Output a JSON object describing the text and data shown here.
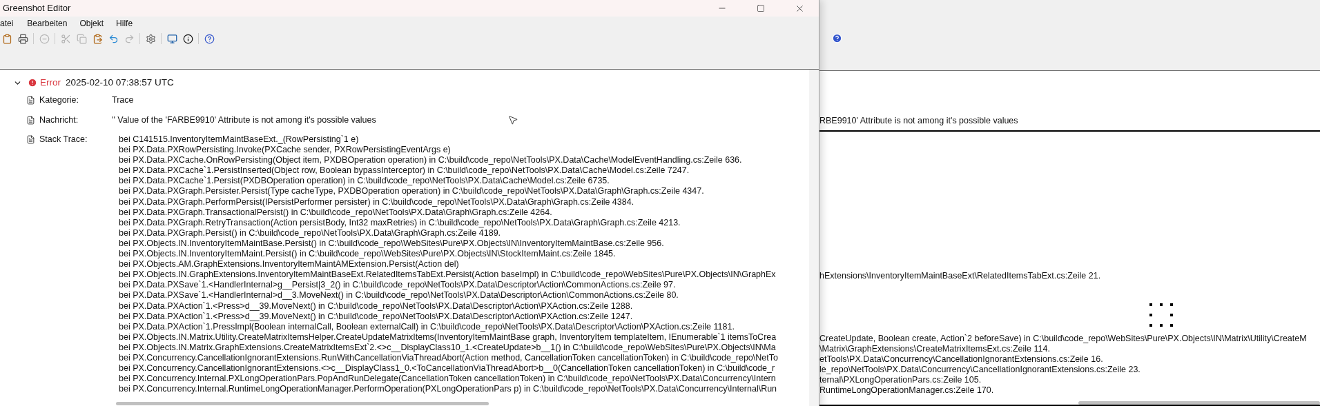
{
  "window": {
    "title": "Greenshot Editor"
  },
  "menu": [
    "atei",
    "Bearbeiten",
    "Objekt",
    "Hilfe"
  ],
  "toolbar": [
    {
      "disabled": false
    },
    {
      "disabled": false
    },
    {
      "disabled": true
    },
    {
      "disabled": true
    },
    {
      "disabled": true
    },
    {
      "disabled": false
    },
    {
      "disabled": false
    },
    {
      "disabled": true
    },
    {
      "disabled": false
    },
    {
      "disabled": false
    },
    {
      "disabled": false
    },
    {
      "disabled": false
    }
  ],
  "log_entry": {
    "expanded": true,
    "level": "Error",
    "timestamp": "2025-02-10 07:38:57 UTC",
    "fields": [
      {
        "label": "Kategorie:",
        "value": "Trace"
      },
      {
        "label": "Nachricht:",
        "value": "'' Value of the 'FARBE9910' Attribute is not among it's possible values",
        "continuation": "RBE9910' Attribute is not among it's possible values"
      }
    ],
    "stack_trace": {
      "label": "Stack Trace:",
      "lines": [
        {
          "text": "bei C141515.InventoryItemMaintBaseExt._(RowPersisting`1 e)"
        },
        {
          "text": "bei PX.Data.PXRowPersisting.Invoke(PXCache sender, PXRowPersistingEventArgs e)"
        },
        {
          "text": "bei PX.Data.PXCache.OnRowPersisting(Object item, PXDBOperation operation) in C:\\build\\code_repo\\NetTools\\PX.Data\\Cache\\ModelEventHandling.cs:Zeile 636."
        },
        {
          "text": "bei PX.Data.PXCache`1.PersistInserted(Object row, Boolean bypassInterceptor) in C:\\build\\code_repo\\NetTools\\PX.Data\\Cache\\Model.cs:Zeile 7247."
        },
        {
          "text": "bei PX.Data.PXCache`1.Persist(PXDBOperation operation) in C:\\build\\code_repo\\NetTools\\PX.Data\\Cache\\Model.cs:Zeile 6735."
        },
        {
          "text": "bei PX.Data.PXGraph.Persister.Persist(Type cacheType, PXDBOperation operation) in C:\\build\\code_repo\\NetTools\\PX.Data\\Graph\\Graph.cs:Zeile 4347."
        },
        {
          "text": "bei PX.Data.PXGraph.PerformPersist(IPersistPerformer persister) in C:\\build\\code_repo\\NetTools\\PX.Data\\Graph\\Graph.cs:Zeile 4384."
        },
        {
          "text": "bei PX.Data.PXGraph.TransactionalPersist() in C:\\build\\code_repo\\NetTools\\PX.Data\\Graph\\Graph.cs:Zeile 4264."
        },
        {
          "text": "bei PX.Data.PXGraph.RetryTransaction(Action persistBody, Int32 maxRetries) in C:\\build\\code_repo\\NetTools\\PX.Data\\Graph\\Graph.cs:Zeile 4213."
        },
        {
          "text": "bei PX.Data.PXGraph.Persist() in C:\\build\\code_repo\\NetTools\\PX.Data\\Graph\\Graph.cs:Zeile 4189."
        },
        {
          "text": "bei PX.Objects.IN.InventoryItemMaintBase.Persist() in C:\\build\\code_repo\\WebSites\\Pure\\PX.Objects\\IN\\InventoryItemMaintBase.cs:Zeile 956."
        },
        {
          "text": "bei PX.Objects.IN.InventoryItemMaint.Persist() in C:\\build\\code_repo\\WebSites\\Pure\\PX.Objects\\IN\\StockItemMaint.cs:Zeile 1845."
        },
        {
          "text": "bei PX.Objects.AM.GraphExtensions.InventoryItemMaintAMExtension.Persist(Action del)"
        },
        {
          "text": "bei PX.Objects.IN.GraphExtensions.InventoryItemMaintBaseExt.RelatedItemsTabExt.Persist(Action baseImpl) in C:\\build\\code_repo\\WebSites\\Pure\\PX.Objects\\IN\\GraphEx",
          "continuation": "hExtensions\\InventoryItemMaintBaseExt\\RelatedItemsTabExt.cs:Zeile 21."
        },
        {
          "text": "bei PX.Data.PXSave`1.<HandlerInternal>g__Persist|3_2() in C:\\build\\code_repo\\NetTools\\PX.Data\\Descriptor\\Action\\CommonActions.cs:Zeile 97."
        },
        {
          "text": "bei PX.Data.PXSave`1.<HandlerInternal>d__3.MoveNext() in C:\\build\\code_repo\\NetTools\\PX.Data\\Descriptor\\Action\\CommonActions.cs:Zeile 80."
        },
        {
          "text": "bei PX.Data.PXAction`1.<Press>d__39.MoveNext() in C:\\build\\code_repo\\NetTools\\PX.Data\\Descriptor\\Action\\PXAction.cs:Zeile 1288."
        },
        {
          "text": "bei PX.Data.PXAction`1.<Press>d__39.MoveNext() in C:\\build\\code_repo\\NetTools\\PX.Data\\Descriptor\\Action\\PXAction.cs:Zeile 1247."
        },
        {
          "text": "bei PX.Data.PXAction`1.PressImpl(Boolean internalCall, Boolean externalCall) in C:\\build\\code_repo\\NetTools\\PX.Data\\Descriptor\\Action\\PXAction.cs:Zeile 1181."
        },
        {
          "text": "bei PX.Objects.IN.Matrix.Utility.CreateMatrixItemsHelper.CreateUpdateMatrixItems(InventoryItemMaintBase graph, InventoryItem templateItem, IEnumerable`1 itemsToCrea",
          "continuation": "CreateUpdate, Boolean create, Action`2 beforeSave) in C:\\build\\code_repo\\WebSites\\Pure\\PX.Objects\\IN\\Matrix\\Utility\\CreateM"
        },
        {
          "text": "bei PX.Objects.IN.Matrix.GraphExtensions.CreateMatrixItemsExt`2.<>c__DisplayClass10_1.<CreateUpdate>b__1() in C:\\build\\code_repo\\WebSites\\Pure\\PX.Objects\\IN\\Ma",
          "continuation": "\\Matrix\\GraphExtensions\\CreateMatrixItemsExt.cs:Zeile 114."
        },
        {
          "text": "bei PX.Concurrency.CancellationIgnorantExtensions.RunWithCancellationViaThreadAbort(Action method, CancellationToken cancellationToken) in C:\\build\\code_repo\\NetTo",
          "continuation": "etTools\\PX.Data\\Concurrency\\CancellationIgnorantExtensions.cs:Zeile 16."
        },
        {
          "text": "bei PX.Concurrency.CancellationIgnorantExtensions.<>c__DisplayClass1_0.<ToCancellationViaThreadAbort>b__0(CancellationToken cancellationToken) in C:\\build\\code_r",
          "continuation": "le_repo\\NetTools\\PX.Data\\Concurrency\\CancellationIgnorantExtensions.cs:Zeile 23."
        },
        {
          "text": "bei PX.Concurrency.Internal.PXLongOperationPars.PopAndRunDelegate(CancellationToken cancellationToken) in C:\\build\\code_repo\\NetTools\\PX.Data\\Concurrency\\Intern",
          "continuation": "ternal\\PXLongOperationPars.cs:Zeile 105."
        },
        {
          "text": "bei PX.Concurrency.Internal.RuntimeLongOperationManager.PerformOperation(PXLongOperationPars p) in C:\\build\\code_repo\\NetTools\\PX.Data\\Concurrency\\Internal\\Run",
          "continuation": "RuntimeLongOperationManager.cs:Zeile 170."
        }
      ]
    }
  }
}
